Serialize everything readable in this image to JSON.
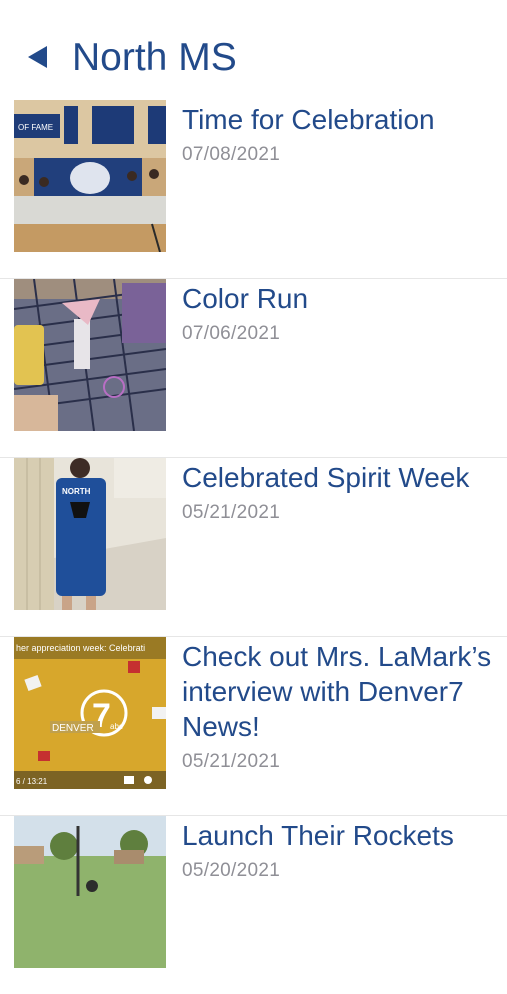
{
  "header": {
    "title": "North MS"
  },
  "items": [
    {
      "title": "Time for Celebration",
      "date": "07/08/2021"
    },
    {
      "title": "Color Run",
      "date": "07/06/2021"
    },
    {
      "title": "Celebrated Spirit Week",
      "date": "05/21/2021"
    },
    {
      "title": "Check out Mrs. LaMark’s interview with Denver7 News!",
      "date": "05/21/2021",
      "thumb_text": {
        "caption": "her appreciation week: Celebrati",
        "logo": "DENVER",
        "channel": "7",
        "network": "abc",
        "time": "6 / 13:21"
      }
    },
    {
      "title": "Launch Their Rockets",
      "date": "05/20/2021"
    }
  ],
  "thumb_labels": {
    "banner": "OF FAME",
    "jersey": "NORTH"
  },
  "colors": {
    "accent": "#224a8a",
    "date_gray": "#8f8f96"
  }
}
